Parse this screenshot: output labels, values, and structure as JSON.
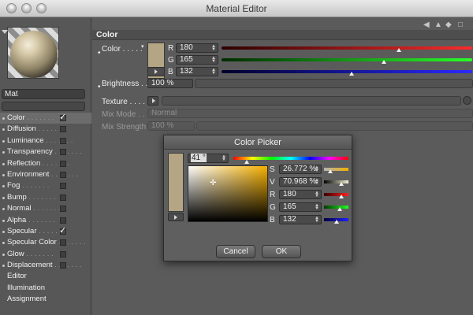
{
  "window": {
    "title": "Material Editor"
  },
  "sidebar": {
    "material_name": "Mat",
    "channels": [
      {
        "label": "Color",
        "checked": true,
        "active": true,
        "dots": true
      },
      {
        "label": "Diffusion",
        "checked": false,
        "dots": false
      },
      {
        "label": "Luminance",
        "checked": false,
        "dots": false
      },
      {
        "label": "Transparency",
        "checked": false,
        "dots": false
      },
      {
        "label": "Reflection",
        "checked": false,
        "dots": false
      },
      {
        "label": "Environment",
        "checked": false,
        "dots": false
      },
      {
        "label": "Fog",
        "checked": false,
        "dots": false
      },
      {
        "label": "Bump",
        "checked": false,
        "dots": false
      },
      {
        "label": "Normal",
        "checked": false,
        "dots": false
      },
      {
        "label": "Alpha",
        "checked": false,
        "dots": false
      },
      {
        "label": "Specular",
        "checked": true,
        "dots": false
      },
      {
        "label": "Specular Color",
        "checked": false,
        "dots": false
      },
      {
        "label": "Glow",
        "checked": false,
        "dots": false
      },
      {
        "label": "Displacement",
        "checked": false,
        "dots": false
      },
      {
        "label": "Editor",
        "checked": null,
        "dots": false
      },
      {
        "label": "Illumination",
        "checked": null,
        "dots": false
      },
      {
        "label": "Assignment",
        "checked": null,
        "dots": false
      }
    ]
  },
  "color_section": {
    "header": "Color",
    "color_label": "Color . . . . .",
    "swatch_color": "#b4a584",
    "channels": [
      {
        "name": "R",
        "value": "180",
        "level": 0.706,
        "track": "linear-gradient(90deg,#2a0000,#ff2a2a)"
      },
      {
        "name": "G",
        "value": "165",
        "level": 0.647,
        "track": "linear-gradient(90deg,#002a00,#2aff2a)"
      },
      {
        "name": "B",
        "value": "132",
        "level": 0.518,
        "track": "linear-gradient(90deg,#00002a,#2a2aff)"
      }
    ],
    "brightness_label": "Brightness . .",
    "brightness_value": "100 %",
    "texture_label": "Texture . . . . .",
    "mix_mode_label": "Mix Mode . .",
    "mix_mode_value": "Normal",
    "mix_strength_label": "Mix Strength",
    "mix_strength_value": "100 %"
  },
  "color_picker": {
    "title": "Color Picker",
    "hue_value": "41 °",
    "hue_level": 0.114,
    "swatch_color": "#b4a584",
    "fields": [
      {
        "name": "S",
        "value": "26.772 %",
        "level": 0.27,
        "track": "linear-gradient(90deg,#b4b4b4,#f0b000)"
      },
      {
        "name": "V",
        "value": "70.968 %",
        "level": 0.71,
        "track": "linear-gradient(90deg,#000000,#f0f0d0)"
      },
      {
        "name": "R",
        "value": "180",
        "level": 0.706,
        "track": "linear-gradient(90deg,#3a0000,#ff2020)"
      },
      {
        "name": "G",
        "value": "165",
        "level": 0.647,
        "track": "linear-gradient(90deg,#003a00,#20ff20)"
      },
      {
        "name": "B",
        "value": "132",
        "level": 0.518,
        "track": "linear-gradient(90deg,#00003a,#2020ff)"
      }
    ],
    "cancel_label": "Cancel",
    "ok_label": "OK"
  }
}
